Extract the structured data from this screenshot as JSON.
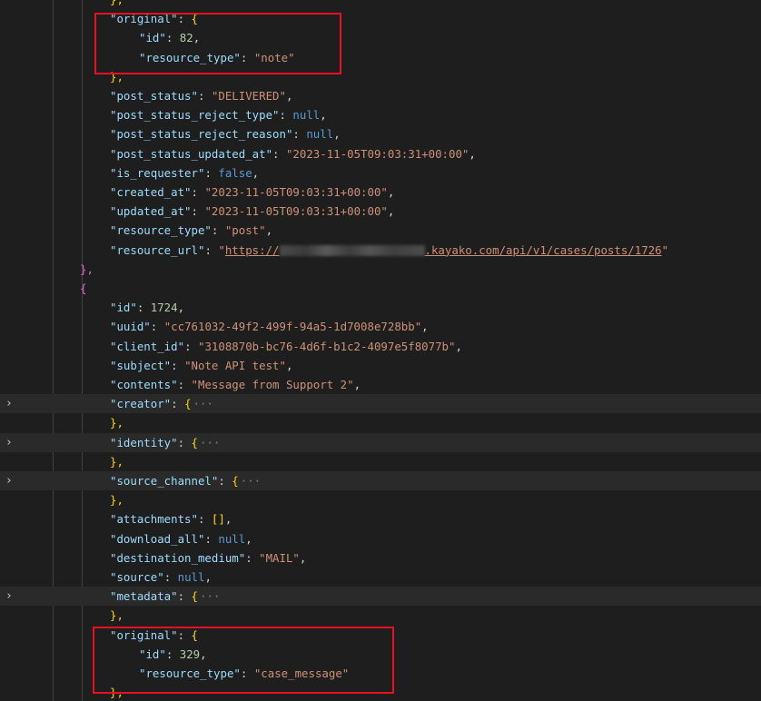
{
  "lines": [
    {
      "indent": 2,
      "tokens": [
        {
          "t": "},",
          "c": "b"
        }
      ]
    },
    {
      "indent": 2,
      "tokens": [
        {
          "t": "\"original\"",
          "c": "k"
        },
        {
          "t": ": ",
          "c": "p"
        },
        {
          "t": "{",
          "c": "b"
        }
      ]
    },
    {
      "indent": 3,
      "tokens": [
        {
          "t": "\"id\"",
          "c": "k"
        },
        {
          "t": ": ",
          "c": "p"
        },
        {
          "t": "82",
          "c": "n"
        },
        {
          "t": ",",
          "c": "p"
        }
      ]
    },
    {
      "indent": 3,
      "tokens": [
        {
          "t": "\"resource_type\"",
          "c": "k"
        },
        {
          "t": ": ",
          "c": "p"
        },
        {
          "t": "\"note\"",
          "c": "s"
        }
      ]
    },
    {
      "indent": 2,
      "tokens": [
        {
          "t": "},",
          "c": "b"
        }
      ]
    },
    {
      "indent": 2,
      "tokens": [
        {
          "t": "\"post_status\"",
          "c": "k"
        },
        {
          "t": ": ",
          "c": "p"
        },
        {
          "t": "\"DELIVERED\"",
          "c": "s"
        },
        {
          "t": ",",
          "c": "p"
        }
      ]
    },
    {
      "indent": 2,
      "tokens": [
        {
          "t": "\"post_status_reject_type\"",
          "c": "k"
        },
        {
          "t": ": ",
          "c": "p"
        },
        {
          "t": "null",
          "c": "kw"
        },
        {
          "t": ",",
          "c": "p"
        }
      ]
    },
    {
      "indent": 2,
      "tokens": [
        {
          "t": "\"post_status_reject_reason\"",
          "c": "k"
        },
        {
          "t": ": ",
          "c": "p"
        },
        {
          "t": "null",
          "c": "kw"
        },
        {
          "t": ",",
          "c": "p"
        }
      ]
    },
    {
      "indent": 2,
      "tokens": [
        {
          "t": "\"post_status_updated_at\"",
          "c": "k"
        },
        {
          "t": ": ",
          "c": "p"
        },
        {
          "t": "\"2023-11-05T09:03:31+00:00\"",
          "c": "s"
        },
        {
          "t": ",",
          "c": "p"
        }
      ]
    },
    {
      "indent": 2,
      "tokens": [
        {
          "t": "\"is_requester\"",
          "c": "k"
        },
        {
          "t": ": ",
          "c": "p"
        },
        {
          "t": "false",
          "c": "kw"
        },
        {
          "t": ",",
          "c": "p"
        }
      ]
    },
    {
      "indent": 2,
      "tokens": [
        {
          "t": "\"created_at\"",
          "c": "k"
        },
        {
          "t": ": ",
          "c": "p"
        },
        {
          "t": "\"2023-11-05T09:03:31+00:00\"",
          "c": "s"
        },
        {
          "t": ",",
          "c": "p"
        }
      ]
    },
    {
      "indent": 2,
      "tokens": [
        {
          "t": "\"updated_at\"",
          "c": "k"
        },
        {
          "t": ": ",
          "c": "p"
        },
        {
          "t": "\"2023-11-05T09:03:31+00:00\"",
          "c": "s"
        },
        {
          "t": ",",
          "c": "p"
        }
      ]
    },
    {
      "indent": 2,
      "tokens": [
        {
          "t": "\"resource_type\"",
          "c": "k"
        },
        {
          "t": ": ",
          "c": "p"
        },
        {
          "t": "\"post\"",
          "c": "s"
        },
        {
          "t": ",",
          "c": "p"
        }
      ]
    },
    {
      "indent": 2,
      "tokens": [
        {
          "t": "\"resource_url\"",
          "c": "k"
        },
        {
          "t": ": ",
          "c": "p"
        },
        {
          "t": "\"",
          "c": "s"
        },
        {
          "t": "https://",
          "c": "link"
        },
        {
          "t": "",
          "c": "blur"
        },
        {
          "t": ".kayako.com/api/v1/cases/posts/1726",
          "c": "link"
        },
        {
          "t": "\"",
          "c": "s"
        }
      ]
    },
    {
      "indent": 1,
      "tokens": [
        {
          "t": "},",
          "c": "b2"
        }
      ]
    },
    {
      "indent": 1,
      "tokens": [
        {
          "t": "{",
          "c": "b2"
        }
      ]
    },
    {
      "indent": 2,
      "tokens": [
        {
          "t": "\"id\"",
          "c": "k"
        },
        {
          "t": ": ",
          "c": "p"
        },
        {
          "t": "1724",
          "c": "n"
        },
        {
          "t": ",",
          "c": "p"
        }
      ]
    },
    {
      "indent": 2,
      "tokens": [
        {
          "t": "\"uuid\"",
          "c": "k"
        },
        {
          "t": ": ",
          "c": "p"
        },
        {
          "t": "\"cc761032-49f2-499f-94a5-1d7008e728bb\"",
          "c": "s"
        },
        {
          "t": ",",
          "c": "p"
        }
      ]
    },
    {
      "indent": 2,
      "tokens": [
        {
          "t": "\"client_id\"",
          "c": "k"
        },
        {
          "t": ": ",
          "c": "p"
        },
        {
          "t": "\"3108870b-bc76-4d6f-b1c2-4097e5f8077b\"",
          "c": "s"
        },
        {
          "t": ",",
          "c": "p"
        }
      ]
    },
    {
      "indent": 2,
      "tokens": [
        {
          "t": "\"subject\"",
          "c": "k"
        },
        {
          "t": ": ",
          "c": "p"
        },
        {
          "t": "\"Note API test\"",
          "c": "s"
        },
        {
          "t": ",",
          "c": "p"
        }
      ]
    },
    {
      "indent": 2,
      "tokens": [
        {
          "t": "\"contents\"",
          "c": "k"
        },
        {
          "t": ": ",
          "c": "p"
        },
        {
          "t": "\"Message from Support 2\"",
          "c": "s"
        },
        {
          "t": ",",
          "c": "p"
        }
      ]
    },
    {
      "indent": 2,
      "folded": true,
      "tokens": [
        {
          "t": "\"creator\"",
          "c": "k"
        },
        {
          "t": ": ",
          "c": "p"
        },
        {
          "t": "{",
          "c": "b"
        },
        {
          "t": "···",
          "c": "ellipsis"
        }
      ]
    },
    {
      "indent": 2,
      "tokens": [
        {
          "t": "},",
          "c": "b"
        }
      ]
    },
    {
      "indent": 2,
      "folded": true,
      "tokens": [
        {
          "t": "\"identity\"",
          "c": "k"
        },
        {
          "t": ": ",
          "c": "p"
        },
        {
          "t": "{",
          "c": "b"
        },
        {
          "t": "···",
          "c": "ellipsis"
        }
      ]
    },
    {
      "indent": 2,
      "tokens": [
        {
          "t": "},",
          "c": "b"
        }
      ]
    },
    {
      "indent": 2,
      "folded": true,
      "tokens": [
        {
          "t": "\"source_channel\"",
          "c": "k"
        },
        {
          "t": ": ",
          "c": "p"
        },
        {
          "t": "{",
          "c": "b"
        },
        {
          "t": "···",
          "c": "ellipsis"
        }
      ]
    },
    {
      "indent": 2,
      "tokens": [
        {
          "t": "},",
          "c": "b"
        }
      ]
    },
    {
      "indent": 2,
      "tokens": [
        {
          "t": "\"attachments\"",
          "c": "k"
        },
        {
          "t": ": ",
          "c": "p"
        },
        {
          "t": "[]",
          "c": "b"
        },
        {
          "t": ",",
          "c": "p"
        }
      ]
    },
    {
      "indent": 2,
      "tokens": [
        {
          "t": "\"download_all\"",
          "c": "k"
        },
        {
          "t": ": ",
          "c": "p"
        },
        {
          "t": "null",
          "c": "kw"
        },
        {
          "t": ",",
          "c": "p"
        }
      ]
    },
    {
      "indent": 2,
      "tokens": [
        {
          "t": "\"destination_medium\"",
          "c": "k"
        },
        {
          "t": ": ",
          "c": "p"
        },
        {
          "t": "\"MAIL\"",
          "c": "s"
        },
        {
          "t": ",",
          "c": "p"
        }
      ]
    },
    {
      "indent": 2,
      "tokens": [
        {
          "t": "\"source\"",
          "c": "k"
        },
        {
          "t": ": ",
          "c": "p"
        },
        {
          "t": "null",
          "c": "kw"
        },
        {
          "t": ",",
          "c": "p"
        }
      ]
    },
    {
      "indent": 2,
      "folded": true,
      "tokens": [
        {
          "t": "\"metadata\"",
          "c": "k"
        },
        {
          "t": ": ",
          "c": "p"
        },
        {
          "t": "{",
          "c": "b"
        },
        {
          "t": "···",
          "c": "ellipsis"
        }
      ]
    },
    {
      "indent": 2,
      "tokens": [
        {
          "t": "},",
          "c": "b"
        }
      ]
    },
    {
      "indent": 2,
      "tokens": [
        {
          "t": "\"original\"",
          "c": "k"
        },
        {
          "t": ": ",
          "c": "p"
        },
        {
          "t": "{",
          "c": "b"
        }
      ]
    },
    {
      "indent": 3,
      "tokens": [
        {
          "t": "\"id\"",
          "c": "k"
        },
        {
          "t": ": ",
          "c": "p"
        },
        {
          "t": "329",
          "c": "n"
        },
        {
          "t": ",",
          "c": "p"
        }
      ]
    },
    {
      "indent": 3,
      "tokens": [
        {
          "t": "\"resource_type\"",
          "c": "k"
        },
        {
          "t": ": ",
          "c": "p"
        },
        {
          "t": "\"case_message\"",
          "c": "s"
        }
      ]
    },
    {
      "indent": 2,
      "tokens": [
        {
          "t": "},",
          "c": "b"
        }
      ]
    }
  ],
  "theme": {
    "background": "#1e1e1e",
    "key": "#9cdcfe",
    "string": "#ce9178",
    "number": "#b5cea8",
    "keyword": "#569cd6",
    "highlight_border": "#e81123"
  },
  "fold_icon": "chevron-right-icon",
  "highlights": [
    {
      "label": "original-note-block"
    },
    {
      "label": "original-case-message-block"
    }
  ]
}
